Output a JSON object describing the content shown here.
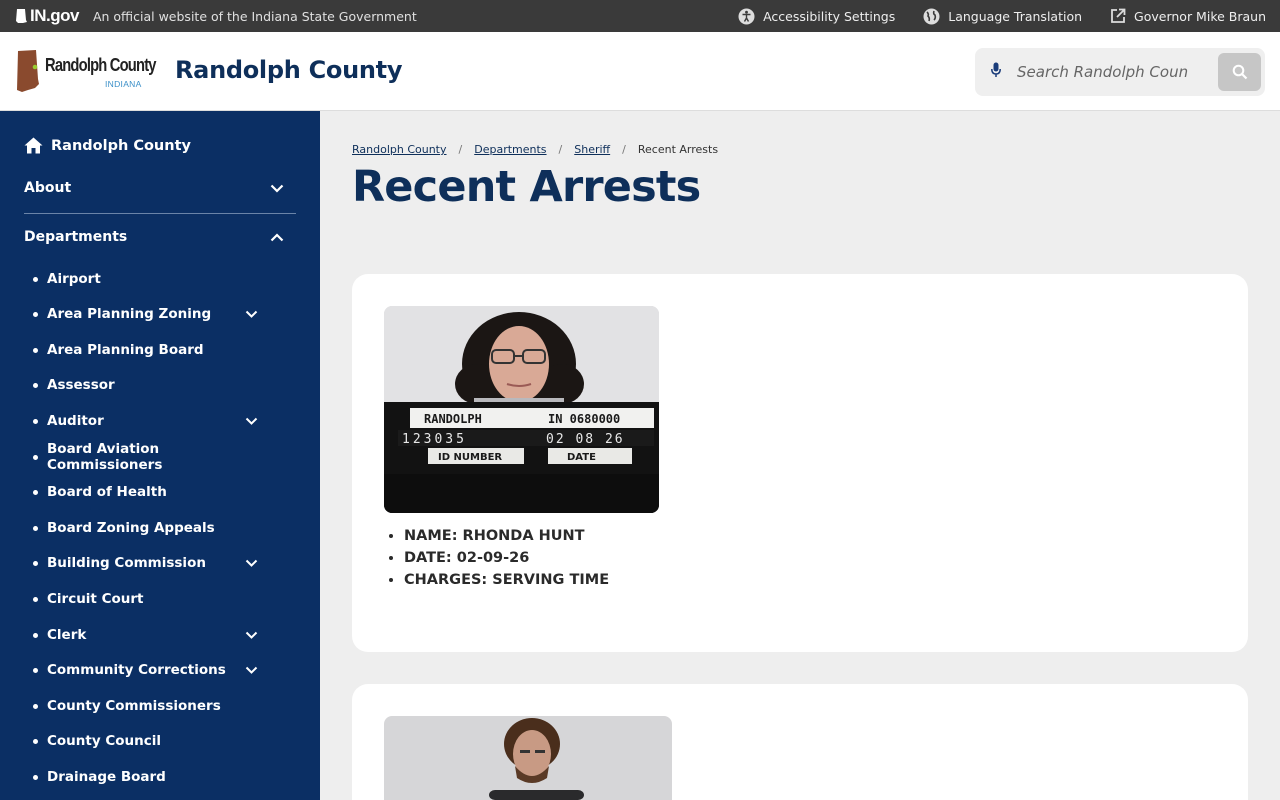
{
  "gov_bar": {
    "logo_text": "IN.gov",
    "official_text": "An official website of the Indiana State Government",
    "links": [
      {
        "label": "Accessibility Settings",
        "icon": "accessibility-icon"
      },
      {
        "label": "Language Translation",
        "icon": "globe-icon"
      },
      {
        "label": "Governor Mike Braun",
        "icon": "external-link-icon"
      }
    ]
  },
  "header": {
    "logo_name": "Randolph County",
    "logo_state": "INDIANA",
    "title": "Randolph County",
    "search_placeholder": "Search Randolph County"
  },
  "sidebar": {
    "home_label": "Randolph County",
    "sections": [
      {
        "label": "About",
        "expanded": false
      },
      {
        "label": "Departments",
        "expanded": true
      }
    ],
    "items": [
      {
        "label": "Airport",
        "has_submenu": false
      },
      {
        "label": "Area Planning Zoning",
        "has_submenu": true
      },
      {
        "label": "Area Planning Board",
        "has_submenu": false
      },
      {
        "label": "Assessor",
        "has_submenu": false
      },
      {
        "label": "Auditor",
        "has_submenu": true
      },
      {
        "label": "Board Aviation Commissioners",
        "has_submenu": false
      },
      {
        "label": "Board of Health",
        "has_submenu": false
      },
      {
        "label": "Board Zoning Appeals",
        "has_submenu": false
      },
      {
        "label": "Building Commission",
        "has_submenu": true
      },
      {
        "label": "Circuit Court",
        "has_submenu": false
      },
      {
        "label": "Clerk",
        "has_submenu": true
      },
      {
        "label": "Community Corrections",
        "has_submenu": true
      },
      {
        "label": "County Commissioners",
        "has_submenu": false
      },
      {
        "label": "County Council",
        "has_submenu": false
      },
      {
        "label": "Drainage Board",
        "has_submenu": false
      }
    ]
  },
  "breadcrumb": [
    {
      "label": "Randolph County",
      "link": true
    },
    {
      "label": "Departments",
      "link": true
    },
    {
      "label": "Sheriff",
      "link": true
    },
    {
      "label": "Recent Arrests",
      "link": false
    }
  ],
  "page_title": "Recent Arrests",
  "arrests": [
    {
      "name": "NAME: RHONDA HUNT",
      "date": "DATE: 02-09-26",
      "charges": "CHARGES: SERVING TIME",
      "placard": {
        "agency": "RANDOLPH",
        "state_id": "IN 0680000",
        "id_number": "123035",
        "photo_date": "02 08 26",
        "id_label": "ID NUMBER",
        "date_label": "DATE"
      }
    }
  ],
  "colors": {
    "brand_navy": "#0e2f5a",
    "sidebar_bg": "#0b2f64",
    "gov_bar_bg": "#3a3a3a",
    "page_bg": "#eeeeee"
  }
}
